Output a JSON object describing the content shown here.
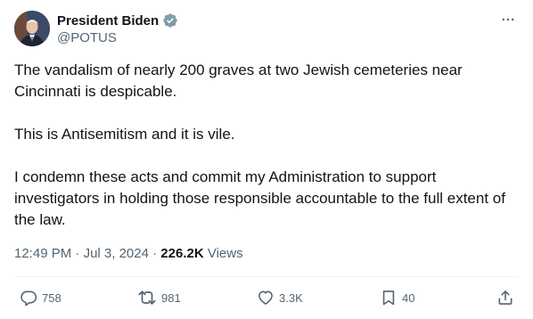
{
  "author": {
    "display_name": "President Biden",
    "handle": "@POTUS",
    "avatar_icon": "portrait-avatar",
    "verified_color": "#829aab"
  },
  "tweet": {
    "paragraphs": [
      "The vandalism of nearly 200 graves at two Jewish cemeteries near Cincinnati is despicable.",
      "This is Antisemitism and it is vile.",
      "I condemn these acts and commit my Administration to support investigators in holding those responsible accountable to the full extent of the law."
    ],
    "time": "12:49 PM",
    "date": "Jul 3, 2024",
    "separator": "·",
    "views_count": "226.2K",
    "views_label": "Views"
  },
  "actions": {
    "replies": "758",
    "reposts": "981",
    "likes": "3.3K",
    "bookmarks": "40"
  },
  "colors": {
    "text_primary": "#0f1419",
    "text_secondary": "#536471",
    "divider": "#eff3f4"
  }
}
